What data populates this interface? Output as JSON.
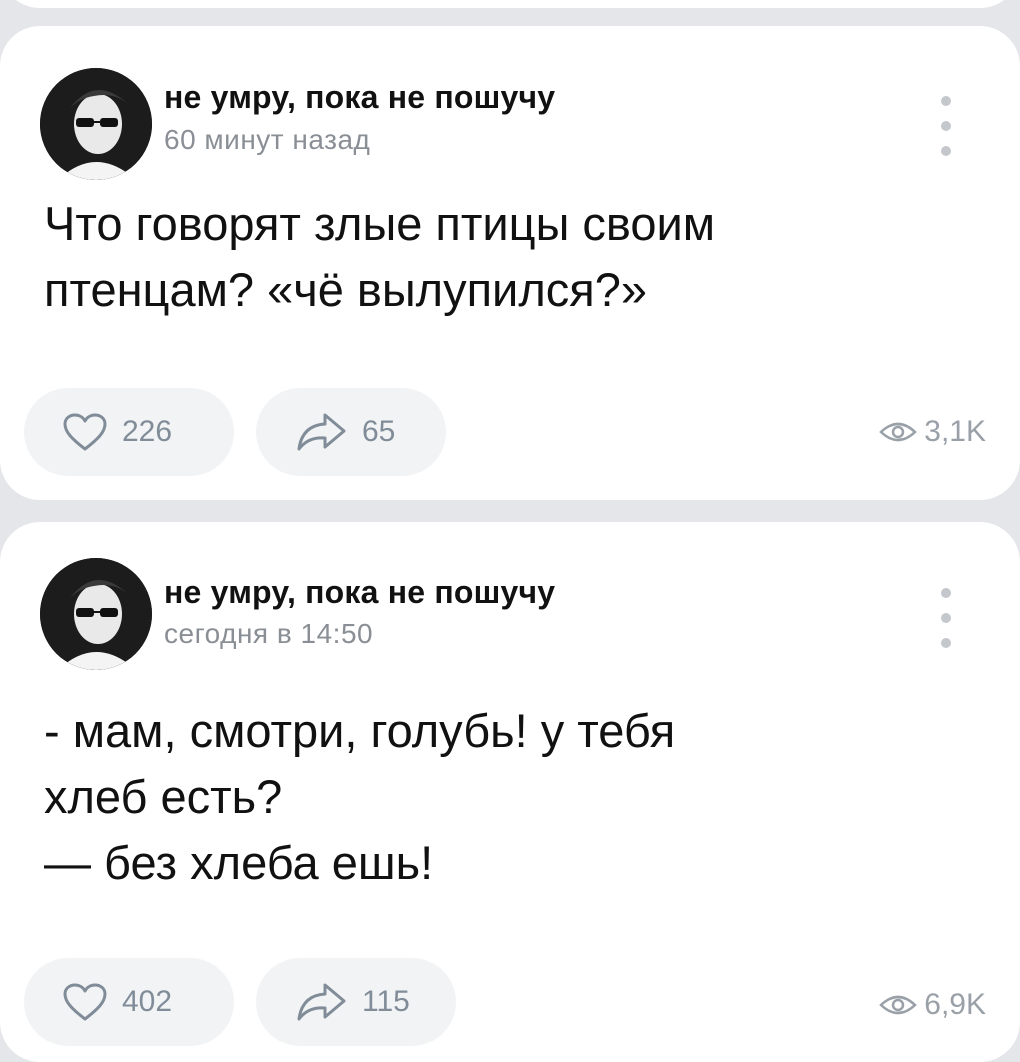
{
  "posts": [
    {
      "author": "не умру, пока не пошучу",
      "time": "60 минут назад",
      "text": "Что говорят злые птицы своим\nптенцам? «чё вылупился?»",
      "likes": "226",
      "shares": "65",
      "views": "3,1K"
    },
    {
      "author": "не умру, пока не пошучу",
      "time": "сегодня в 14:50",
      "text": "-  мам, смотри, голубь! у тебя\nхлеб есть?\n— без хлеба ешь!",
      "likes": "402",
      "shares": "115",
      "views": "6,9K"
    }
  ],
  "icons": {
    "like": "heart-icon",
    "share": "share-arrow-icon",
    "views": "eye-icon",
    "menu": "more-vertical-icon"
  }
}
